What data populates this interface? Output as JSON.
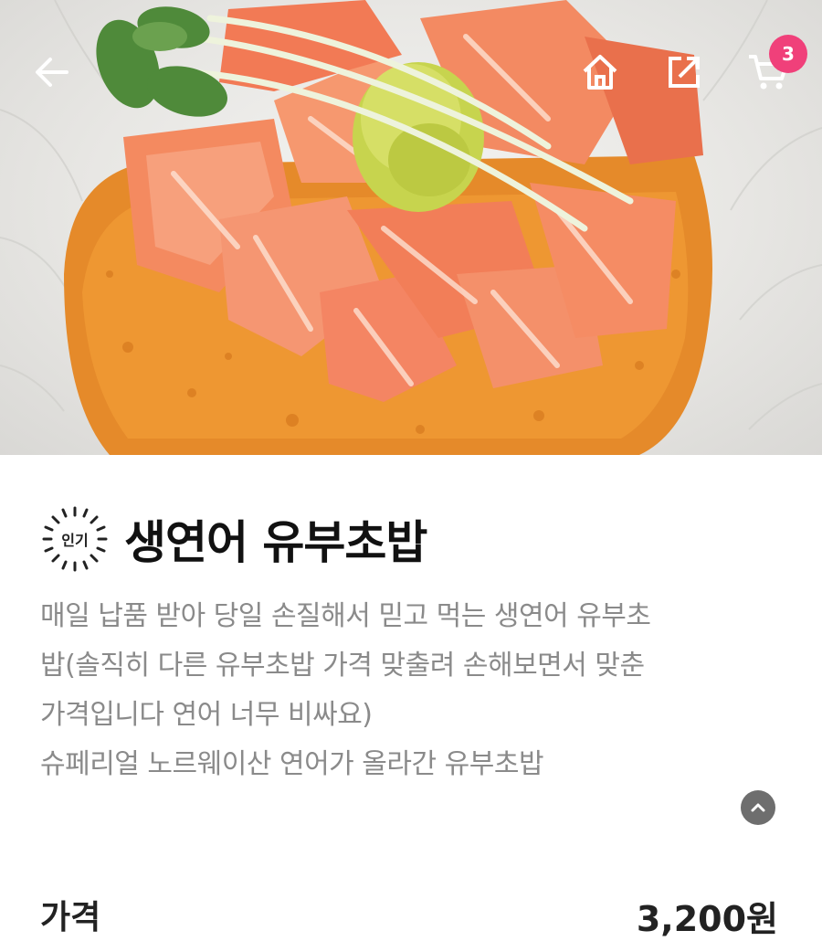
{
  "header": {
    "back_icon": "back-arrow-icon",
    "home_icon": "home-icon",
    "share_icon": "share-icon",
    "cart_icon": "cart-icon",
    "cart_count": "3",
    "badge_color": "#f0407a"
  },
  "product": {
    "badge_label": "인기",
    "name": "생연어 유부초밥",
    "description_lines": [
      "매일 납품 받아 당일 손질해서 믿고 먹는 생연어 유부초",
      "밥(솔직히 다른 유부초밥 가격 맞출려 손해보면서 맞춘",
      "가격입니다 연어 너무 비싸요)",
      "슈페리얼 노르웨이산 연어가 올라간 유부초밥"
    ],
    "collapse_icon": "chevron-up-icon"
  },
  "price": {
    "label": "가격",
    "value": "3,200원"
  }
}
